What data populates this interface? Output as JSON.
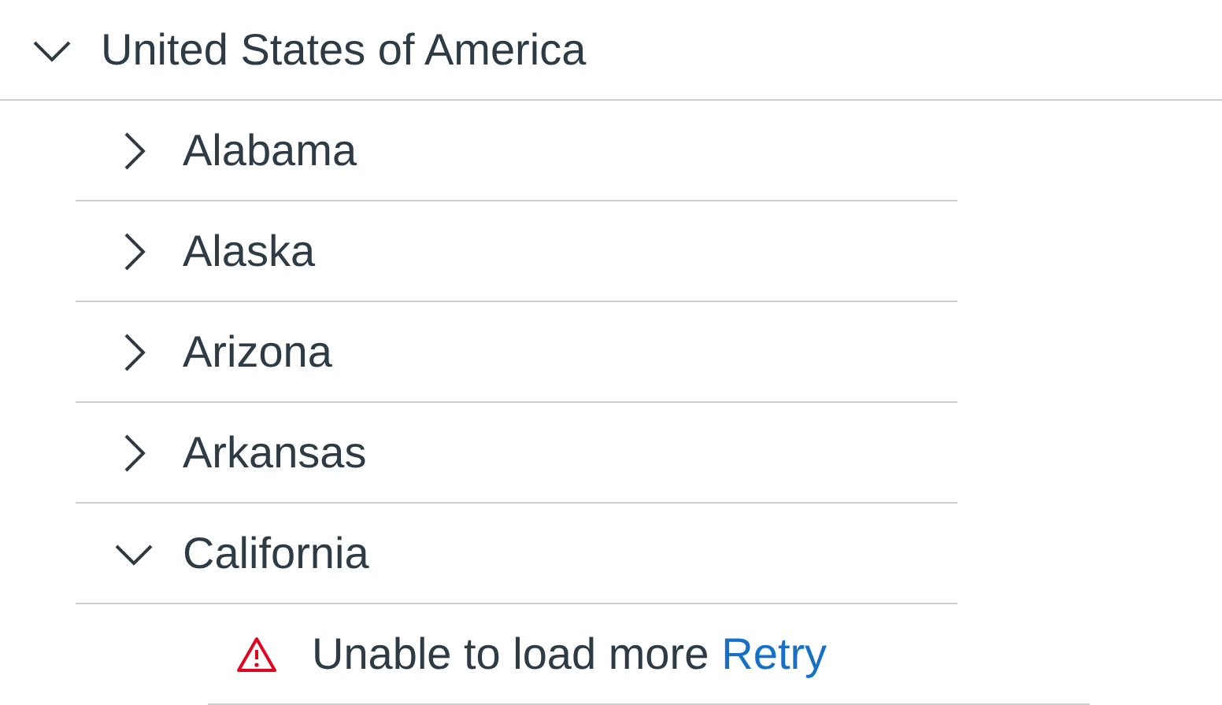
{
  "tree": {
    "label": "United States of America",
    "expanded": true,
    "children": [
      {
        "label": "Alabama",
        "expanded": false
      },
      {
        "label": "Alaska",
        "expanded": false
      },
      {
        "label": "Arizona",
        "expanded": false
      },
      {
        "label": "Arkansas",
        "expanded": false
      },
      {
        "label": "California",
        "expanded": true,
        "children": [
          {
            "kind": "error",
            "message": "Unable to load more",
            "action": "Retry"
          }
        ]
      }
    ]
  }
}
